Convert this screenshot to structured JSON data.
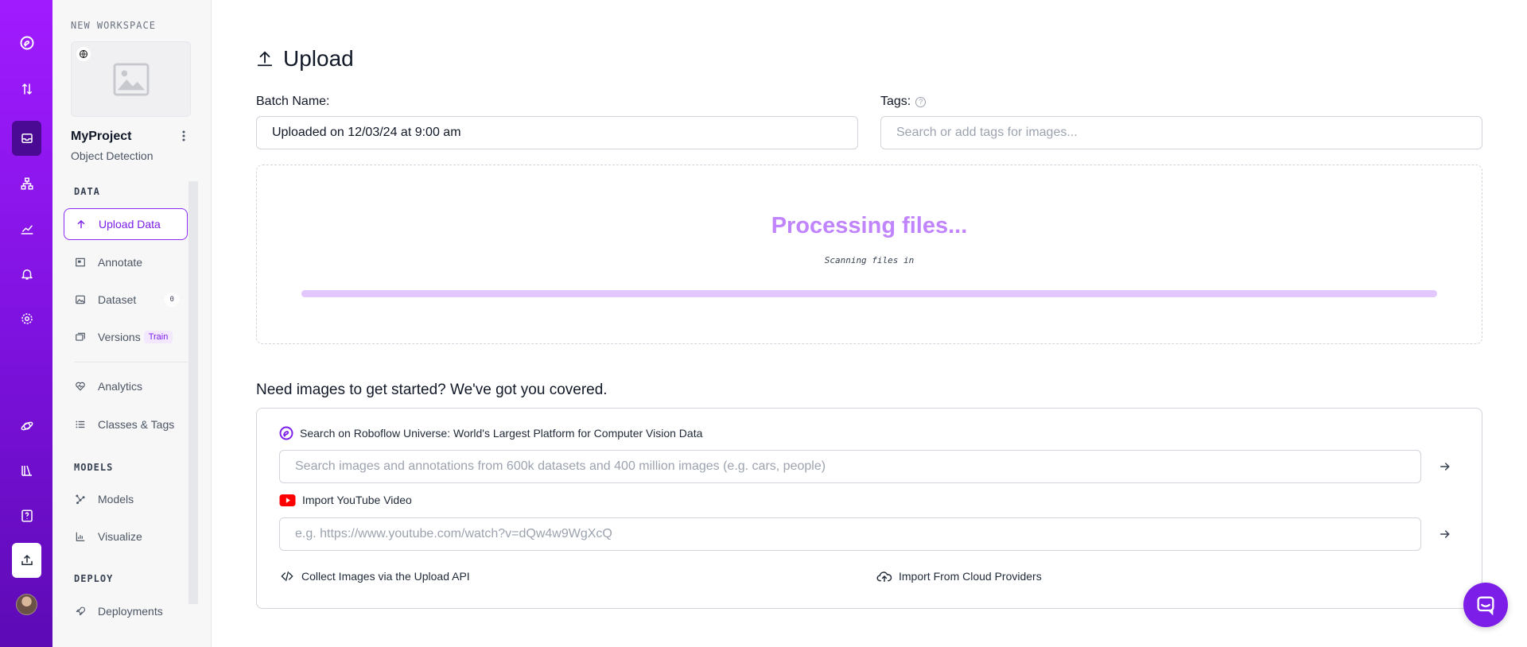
{
  "sidebar": {
    "workspace_label": "NEW WORKSPACE",
    "project_name": "MyProject",
    "project_type": "Object Detection",
    "sections": {
      "data": "DATA",
      "models": "MODELS",
      "deploy": "DEPLOY"
    },
    "items": [
      {
        "label": "Upload Data",
        "icon": "upload-arrow-icon"
      },
      {
        "label": "Annotate",
        "icon": "annotate-icon"
      },
      {
        "label": "Dataset",
        "icon": "image-icon",
        "count": "0"
      },
      {
        "label": "Versions",
        "icon": "versions-icon",
        "badge": "Train"
      },
      {
        "label": "Analytics",
        "icon": "heart-pulse-icon"
      },
      {
        "label": "Classes & Tags",
        "icon": "list-icon"
      },
      {
        "label": "Models",
        "icon": "nodes-icon"
      },
      {
        "label": "Visualize",
        "icon": "bar-chart-icon"
      },
      {
        "label": "Deployments",
        "icon": "rocket-icon"
      }
    ]
  },
  "main": {
    "title": "Upload",
    "batch_label": "Batch Name:",
    "batch_value": "Uploaded on 12/03/24 at 9:00 am",
    "tags_label": "Tags:",
    "tags_placeholder": "Search or add tags for images...",
    "processing_title": "Processing files...",
    "processing_sub": "Scanning files in",
    "progress_fraction": 1.0,
    "resources_heading": "Need images to get started? We've got you covered.",
    "universe_label": "Search on Roboflow Universe: World's Largest Platform for Computer Vision Data",
    "universe_placeholder": "Search images and annotations from 600k datasets and 400 million images (e.g. cars, people)",
    "youtube_label": "Import YouTube Video",
    "youtube_placeholder": "e.g. https://www.youtube.com/watch?v=dQw4w9WgXcQ",
    "api_link": "Collect Images via the Upload API",
    "cloud_link": "Import From Cloud Providers"
  },
  "colors": {
    "brand": "#8b2cf5",
    "accent_light": "#c084fc",
    "youtube_red": "#ff0000"
  }
}
